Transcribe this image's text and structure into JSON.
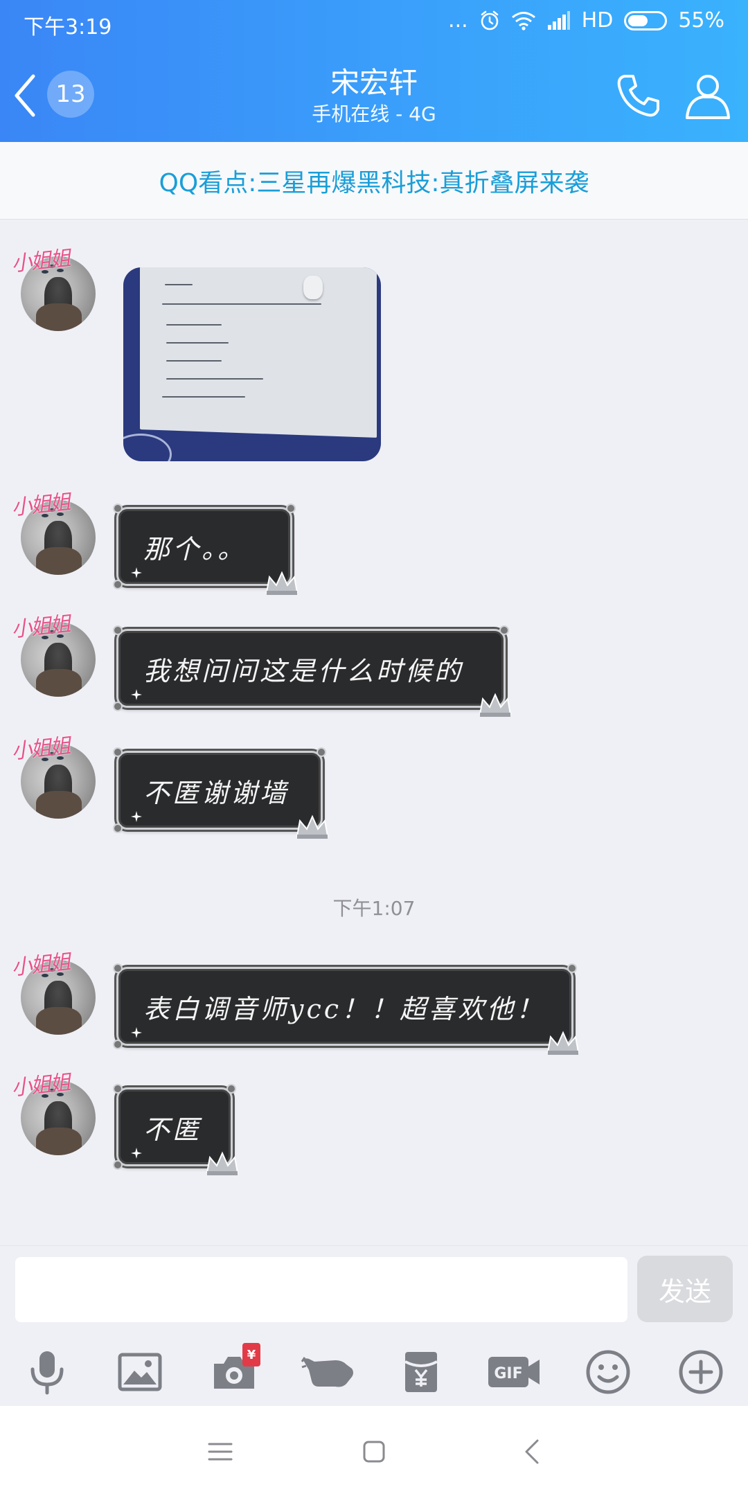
{
  "status_bar": {
    "time": "下午3:19",
    "dots": "...",
    "network": "HD",
    "battery_percent": "55%",
    "battery_level": 0.55
  },
  "header": {
    "unread_count": "13",
    "contact_name": "宋宏轩",
    "contact_status": "手机在线 - 4G",
    "icons": [
      "back-arrow",
      "phone",
      "profile"
    ]
  },
  "banner": {
    "text": "QQ看点:三星再爆黑科技:真折叠屏来袭"
  },
  "chat": {
    "avatar_tag": "小姐姐",
    "messages": [
      {
        "type": "image",
        "description_visible": false
      },
      {
        "type": "text",
        "text": "那个。。"
      },
      {
        "type": "text",
        "text": "我想问问这是什么时候的"
      },
      {
        "type": "text",
        "text": "不匿谢谢墙"
      },
      {
        "type": "text",
        "text": "表白调音师ycc！！超喜欢他！"
      },
      {
        "type": "text",
        "text": "不匿"
      }
    ],
    "time_separator": "下午1:07"
  },
  "input": {
    "value": "",
    "placeholder": "",
    "send_label": "发送"
  },
  "toolbar": {
    "items": [
      "microphone",
      "image",
      "camera",
      "poke",
      "red-packet",
      "gif",
      "emoji",
      "plus"
    ],
    "camera_badge": "¥",
    "gif_label": "GIF"
  },
  "colors": {
    "header_start": "#3a86f6",
    "header_end": "#3ab2fc",
    "banner_text": "#1a9ed8",
    "chat_bg": "#eff0f5",
    "bubble_bg": "#2a2b2d",
    "avatar_tag": "#e8538a",
    "badge_red": "#e23b47"
  }
}
